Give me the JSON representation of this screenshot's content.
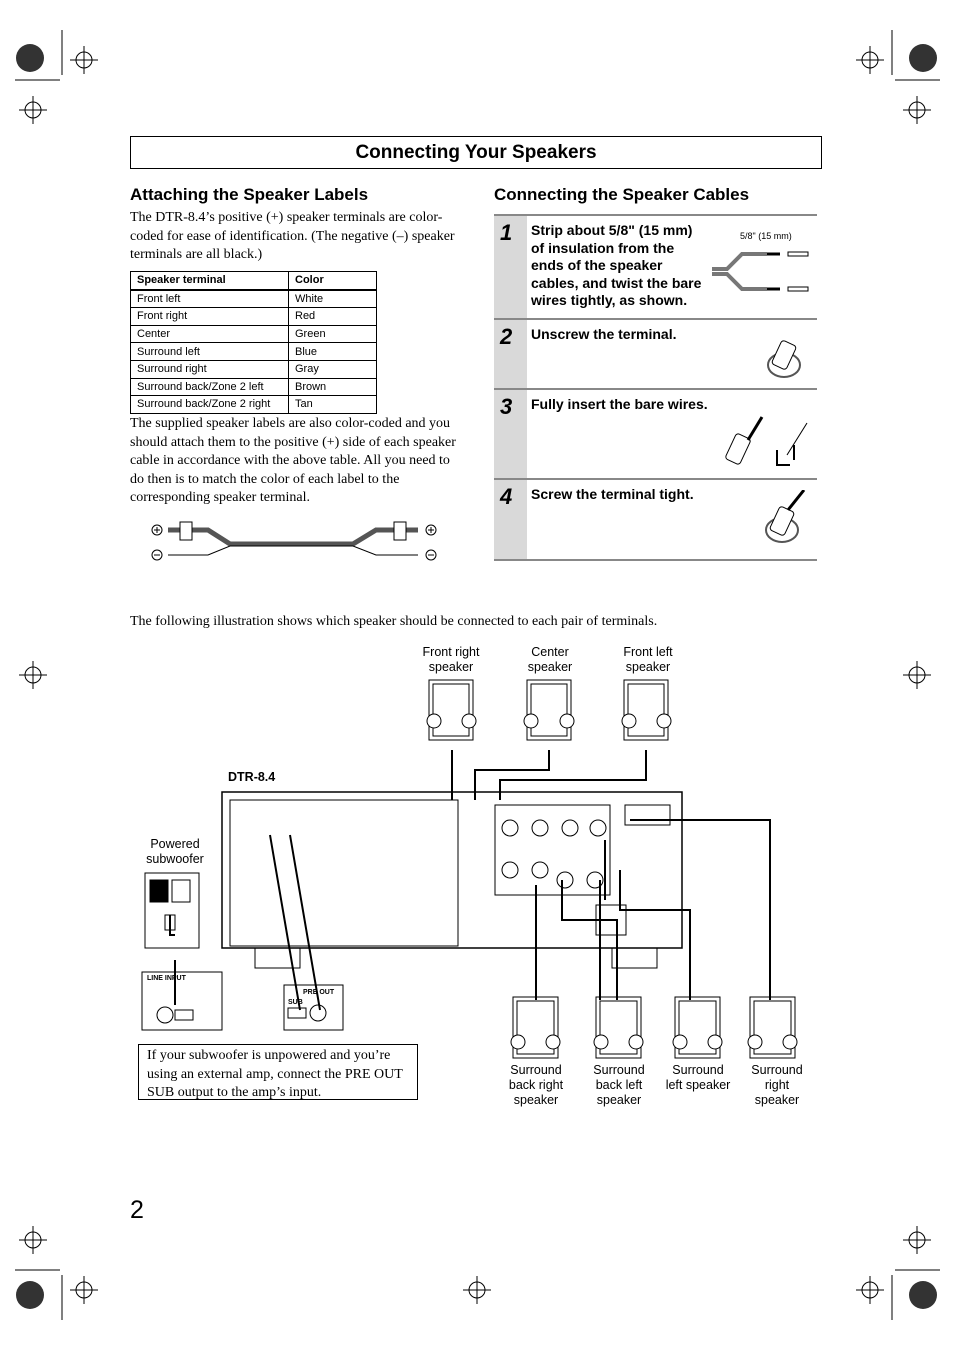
{
  "page_title": "Connecting Your Speakers",
  "left": {
    "heading": "Attaching the Speaker Labels",
    "intro": "The DTR-8.4’s positive (+) speaker terminals are color-coded for ease of identification. (The negative (–) speaker terminals are all black.)",
    "table": {
      "headers": [
        "Speaker terminal",
        "Color"
      ],
      "rows": [
        [
          "Front left",
          "White"
        ],
        [
          "Front right",
          "Red"
        ],
        [
          "Center",
          "Green"
        ],
        [
          "Surround left",
          "Blue"
        ],
        [
          "Surround right",
          "Gray"
        ],
        [
          "Surround back/Zone 2 left",
          "Brown"
        ],
        [
          "Surround back/Zone 2 right",
          "Tan"
        ]
      ]
    },
    "paragraph": "The supplied speaker labels are also color-coded and you should attach them to the positive (+) side of each speaker cable in accordance with the above table. All you need to do then is to match the color of each label to the corresponding speaker terminal."
  },
  "right": {
    "heading": "Connecting the Speaker Cables",
    "steps": [
      {
        "num": "1",
        "text": "Strip about 5/8\" (15 mm) of insulation from the ends of the speaker cables, and twist the bare wires tightly, as shown."
      },
      {
        "num": "2",
        "text": "Unscrew the terminal."
      },
      {
        "num": "3",
        "text": "Fully insert the bare wires."
      },
      {
        "num": "4",
        "text": "Screw the terminal tight."
      }
    ],
    "strip_length_label": "5/8\" (15 mm)"
  },
  "diagram": {
    "intro": "The following illustration shows which speaker should be connected to each pair of terminals.",
    "receiver_label": "DTR-8.4",
    "top_speakers": [
      "Front right speaker",
      "Center speaker",
      "Front left speaker"
    ],
    "bottom_speakers": [
      "Surround back right speaker",
      "Surround back left speaker",
      "Surround left speaker",
      "Surround right speaker"
    ],
    "subwoofer_label": "Powered subwoofer",
    "line_input_label": "LINE INPUT",
    "pre_out_label": "PRE OUT",
    "sub_label": "SUB",
    "note": "If your subwoofer is unpowered and you’re using an external amp, connect the PRE OUT SUB output to the amp’s input."
  },
  "page_number": "2"
}
